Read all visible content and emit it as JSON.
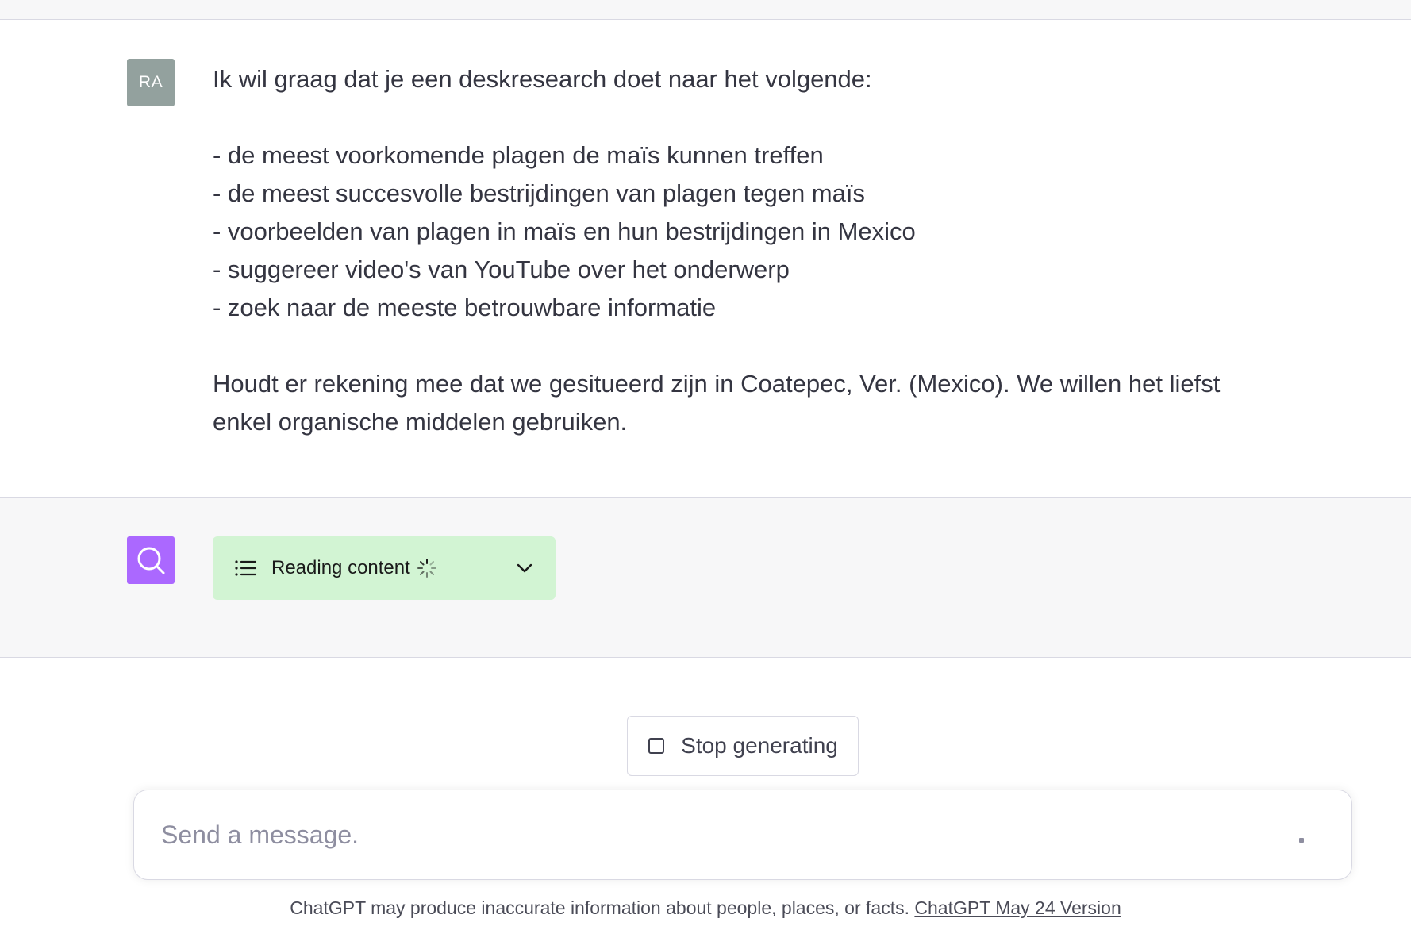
{
  "user": {
    "avatar_initials": "RA",
    "message": {
      "intro": "Ik wil graag dat je een deskresearch doet naar het volgende:",
      "bullets": [
        "- de meest voorkomende plagen de maïs kunnen treffen",
        "- de meest succesvolle bestrijdingen van plagen tegen maïs",
        "- voorbeelden van plagen in maïs en hun bestrijdingen in Mexico",
        "- suggereer video's van YouTube over het onderwerp",
        "- zoek naar de meeste betrouwbare informatie"
      ],
      "closing_line1": "Houdt er rekening mee dat we gesitueerd zijn in Coatepec, Ver. (Mexico). We willen het liefst",
      "closing_line2": "enkel organische middelen gebruiken."
    }
  },
  "assistant": {
    "avatar_icon": "search-icon",
    "avatar_color": "#ab68ff",
    "tool_status": {
      "label": "Reading content",
      "icons": [
        "list-icon",
        "spinner-icon",
        "chevron-down-icon"
      ],
      "background": "#d2f4d3"
    }
  },
  "controls": {
    "stop_label": "Stop generating",
    "stop_icon": "stop-square-icon"
  },
  "composer": {
    "placeholder": "Send a message.",
    "value": ""
  },
  "footer": {
    "disclaimer": "ChatGPT may produce inaccurate information about people, places, or facts. ",
    "version_link": "ChatGPT May 24 Version"
  }
}
